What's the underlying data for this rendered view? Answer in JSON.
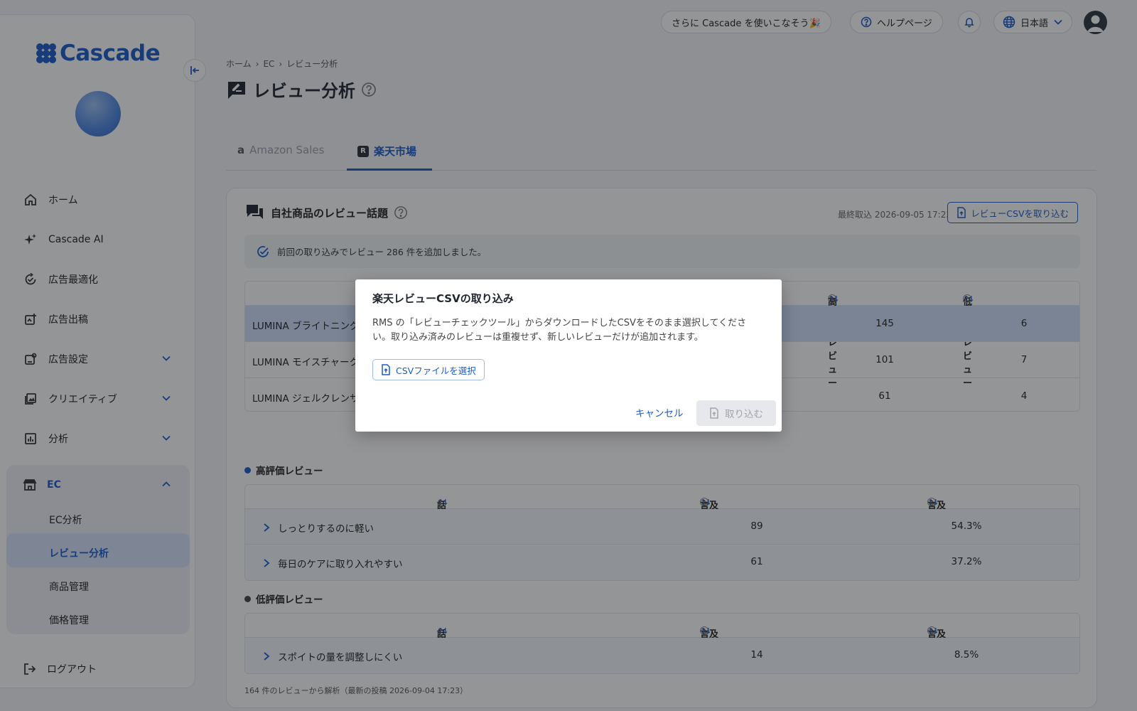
{
  "brand": {
    "name": "Cascade"
  },
  "topbar": {
    "promo": "さらに Cascade を使いこなそう🎉",
    "help": "ヘルプページ",
    "language": "日本語"
  },
  "sidebar": {
    "items": [
      {
        "label": "ホーム"
      },
      {
        "label": "Cascade AI"
      },
      {
        "label": "広告最適化"
      },
      {
        "label": "広告出稿"
      },
      {
        "label": "広告設定"
      },
      {
        "label": "クリエイティブ"
      },
      {
        "label": "分析"
      }
    ],
    "ec": {
      "label": "EC",
      "children": [
        "EC分析",
        "レビュー分析",
        "商品管理",
        "価格管理"
      ]
    },
    "logout": "ログアウト"
  },
  "breadcrumb": [
    "ホーム",
    "EC",
    "レビュー分析"
  ],
  "page": {
    "title": "レビュー分析"
  },
  "tabs": [
    {
      "label": "Amazon Sales"
    },
    {
      "label": "楽天市場",
      "badge": "R"
    }
  ],
  "card": {
    "title": "自社商品のレビュー話題",
    "last_import": "最終取込 2026-09-05 17:23",
    "import_button": "レビューCSVを取り込む",
    "notice": "前回の取り込みでレビュー 286 件を追加しました。",
    "product_table": {
      "headers": {
        "high": "高評価レビュー",
        "low": "低評価レビュー"
      },
      "rows": [
        {
          "name": "LUMINA ブライトニング",
          "high": "145",
          "low": "6"
        },
        {
          "name": "LUMINA モイスチャーク",
          "high": "101",
          "low": "7"
        },
        {
          "name": "LUMINA ジェルクレンサ",
          "high": "61",
          "low": "4"
        }
      ]
    },
    "positive": {
      "label": "高評価レビュー",
      "headers": {
        "topic": "話題",
        "count": "言及レビュー数（推定）",
        "rate": "言及率（推定）"
      },
      "rows": [
        {
          "topic": "しっとりするのに軽い",
          "count": "89",
          "rate": "54.3%"
        },
        {
          "topic": "毎日のケアに取り入れやすい",
          "count": "61",
          "rate": "37.2%"
        }
      ]
    },
    "negative": {
      "label": "低評価レビュー",
      "headers": {
        "topic": "話題",
        "count": "言及レビュー数（推定）",
        "rate": "言及率（推定）"
      },
      "rows": [
        {
          "topic": "スポイトの量を調整しにくい",
          "count": "14",
          "rate": "8.5%"
        }
      ]
    },
    "footnote": "164 件のレビューから解析（最新の投稿 2026-09-04 17:23）"
  },
  "modal": {
    "title": "楽天レビューCSVの取り込み",
    "description": "RMS の「レビューチェックツール」からダウンロードしたCSVをそのまま選択してください。取り込み済みのレビューは重複せず、新しいレビューだけが追加されます。",
    "select_file": "CSVファイルを選択",
    "cancel": "キャンセル",
    "submit": "取り込む"
  }
}
